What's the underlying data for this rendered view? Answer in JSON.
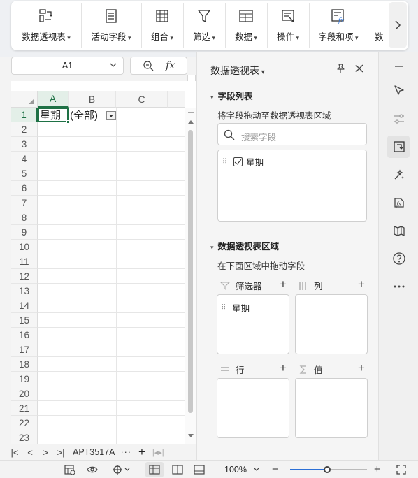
{
  "ribbon": {
    "items": [
      {
        "label": "数据透视表",
        "icon": "pivot-table-icon"
      },
      {
        "label": "活动字段",
        "icon": "active-field-icon"
      },
      {
        "label": "组合",
        "icon": "group-icon"
      },
      {
        "label": "筛选",
        "icon": "filter-icon"
      },
      {
        "label": "数据",
        "icon": "data-icon"
      },
      {
        "label": "操作",
        "icon": "operation-icon"
      },
      {
        "label": "字段和项",
        "icon": "fields-items-icon"
      },
      {
        "label": "数",
        "icon": "more-tools-icon"
      }
    ],
    "more_icon": "chevron-right-icon"
  },
  "formula": {
    "name_box": "A1",
    "fx_label": "fx"
  },
  "sheet": {
    "columns": [
      "A",
      "B",
      "C"
    ],
    "rows": [
      "1",
      "2",
      "3",
      "4",
      "5",
      "6",
      "7",
      "8",
      "9",
      "10",
      "11",
      "12",
      "13",
      "14",
      "15",
      "16",
      "17",
      "18",
      "19",
      "20",
      "21",
      "22",
      "23"
    ],
    "a1": "星期",
    "b1": "(全部)",
    "active_cell": "A1"
  },
  "tabs": {
    "sheet_name": "APT3517A",
    "more": "···",
    "add": "+"
  },
  "status": {
    "zoom": "100%",
    "minus": "−",
    "plus": "+",
    "zoom_fraction": 0.47
  },
  "panel": {
    "title": "数据透视表",
    "field_list_title": "字段列表",
    "field_list_hint": "将字段拖动至数据透视表区域",
    "search_placeholder": "搜索字段",
    "fields": [
      {
        "name": "星期",
        "checked": true
      }
    ],
    "areas_title": "数据透视表区域",
    "areas_hint": "在下面区域中拖动字段",
    "filters_label": "筛选器",
    "columns_label": "列",
    "rows_label": "行",
    "values_label": "值",
    "filter_field": "星期"
  },
  "colors": {
    "accent_green": "#1e7145",
    "slider_blue": "#2b6fd6"
  }
}
